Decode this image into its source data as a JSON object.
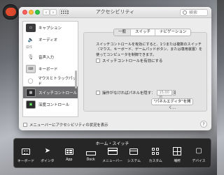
{
  "window": {
    "title": "アクセシビリティ",
    "search_placeholder": "検索"
  },
  "sidebar": {
    "items": [
      {
        "label": "キャプション",
        "icon": "caption-icon"
      },
      {
        "label": "オーディオ",
        "icon": "audio-icon"
      },
      {
        "section": "操作"
      },
      {
        "label": "音声入力",
        "icon": "dictation-icon"
      },
      {
        "label": "キーボード",
        "icon": "keyboard-icon"
      },
      {
        "label": "マウスとトラックパッド",
        "icon": "mouse-icon"
      },
      {
        "label": "スイッチコントロール",
        "icon": "switch-control-icon",
        "selected": true
      },
      {
        "label": "深度コントロール",
        "icon": "dwell-control-icon"
      }
    ]
  },
  "tabs": [
    {
      "label": "一般",
      "active": true
    },
    {
      "label": "スイッチ"
    },
    {
      "label": "ナビゲーション"
    }
  ],
  "panel": {
    "description": "スイッチコントロールを有効にすると、1つまたは複数のスイッチ（マウス、キーボード、ゲームパッドボタン、または専用装置）を使ってコンピュータを制御できます。",
    "enable_switch_label": "スイッチコントロールを有効にする",
    "hide_panel_label": "操作がなければパネルを隠す：",
    "hide_panel_value": "15.00秒",
    "panel_editor_button": "\"パネルエディタ\"を開く..."
  },
  "footer": {
    "menubar_status_label": "メニューバーにアクセシビリティの状況を表示",
    "help_label": "?"
  },
  "home_switch": {
    "title": "ホーム・スイッチ",
    "items": [
      {
        "label": "キーボード",
        "icon": "keyboard-icon"
      },
      {
        "label": "ポインタ",
        "icon": "pointer-icon"
      },
      {
        "label": "App",
        "icon": "app-icon"
      },
      {
        "label": "Dock",
        "icon": "dock-icon"
      },
      {
        "label": "メニューバー",
        "icon": "menubar-icon"
      },
      {
        "label": "システム",
        "icon": "system-icon"
      },
      {
        "label": "カスタム",
        "icon": "custom-icon"
      },
      {
        "label": "場所",
        "icon": "location-icon"
      },
      {
        "label": "デバイス",
        "icon": "device-icon"
      }
    ]
  },
  "colors": {
    "selected_row": "#6f6f72",
    "switch_panel_bg": "#262626",
    "close": "#fc605c",
    "minimize": "#fdbc40",
    "zoom": "#34c84a"
  }
}
